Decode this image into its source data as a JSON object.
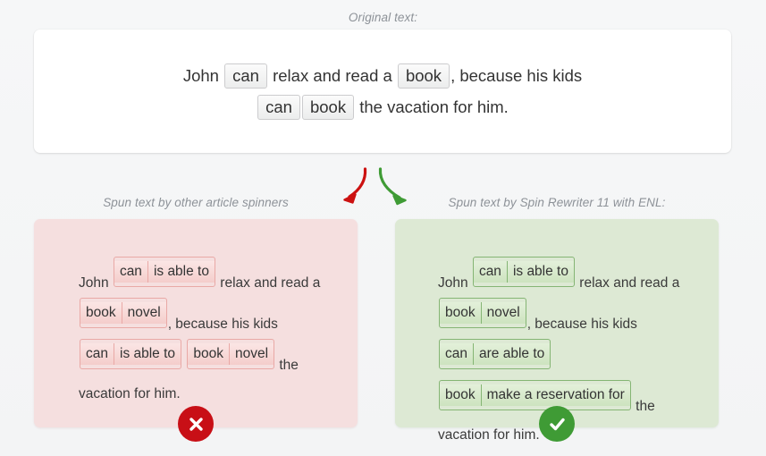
{
  "captions": {
    "original": "Original text:",
    "left": "Spun text by other article spinners",
    "right": "Spun text by Spin Rewriter 11 with ENL:"
  },
  "original_text": {
    "line1": [
      {
        "type": "text",
        "value": "John "
      },
      {
        "type": "chip",
        "value": "can"
      },
      {
        "type": "text",
        "value": " relax and read a "
      },
      {
        "type": "chip",
        "value": "book"
      },
      {
        "type": "text",
        "value": ", because his kids"
      }
    ],
    "line2": [
      {
        "type": "chip",
        "value": "can"
      },
      {
        "type": "chip",
        "value": "book"
      },
      {
        "type": "text",
        "value": " the vacation for him."
      }
    ]
  },
  "panels": [
    {
      "id": "bad",
      "verdict": "incorrect",
      "verdict_icon": "cross-icon",
      "accent": "#c80f16",
      "background": "#f5dfdf",
      "chip_border": "#e9a9a6",
      "tokens": [
        {
          "type": "text",
          "value": "John"
        },
        {
          "type": "pair",
          "original": "can",
          "synonym": "is able to"
        },
        {
          "type": "text",
          "value": "relax and read a"
        },
        {
          "type": "pair",
          "original": "book",
          "synonym": "novel"
        },
        {
          "type": "text",
          "value": ", because his kids"
        },
        {
          "type": "pair",
          "original": "can",
          "synonym": "is able to"
        },
        {
          "type": "pair",
          "original": "book",
          "synonym": "novel"
        },
        {
          "type": "text",
          "value": "the vacation for him."
        }
      ]
    },
    {
      "id": "good",
      "verdict": "correct",
      "verdict_icon": "check-icon",
      "accent": "#3f9b35",
      "background": "#dde9d4",
      "chip_border": "#85b574",
      "tokens": [
        {
          "type": "text",
          "value": "John"
        },
        {
          "type": "pair",
          "original": "can",
          "synonym": "is able to"
        },
        {
          "type": "text",
          "value": "relax and read a"
        },
        {
          "type": "pair",
          "original": "book",
          "synonym": "novel"
        },
        {
          "type": "text",
          "value": ", because his kids"
        },
        {
          "type": "pair",
          "original": "can",
          "synonym": "are able to"
        },
        {
          "type": "pair",
          "original": "book",
          "synonym": "make a reservation for"
        },
        {
          "type": "text",
          "value": "the vacation for him."
        }
      ]
    }
  ],
  "arrows": [
    {
      "name": "red-arrow-to-left-panel",
      "color": "#cc1111",
      "direction": "down-left"
    },
    {
      "name": "green-arrow-to-right-panel",
      "color": "#3f9b35",
      "direction": "down-right"
    }
  ]
}
